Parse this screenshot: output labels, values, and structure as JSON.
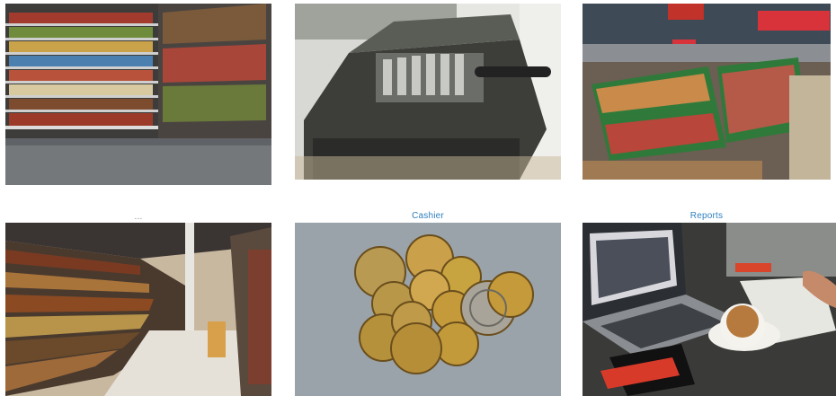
{
  "tiles": [
    {
      "name": "tile-supermarket-aisle",
      "caption": "",
      "image": "supermarket-shelves-photo"
    },
    {
      "name": "tile-cash-register",
      "caption": "",
      "image": "vintage-cash-register-photo"
    },
    {
      "name": "tile-produce-market",
      "caption": "",
      "image": "produce-stands-photo"
    },
    {
      "name": "tile-store-aisle",
      "caption": "...",
      "image": "store-aisle-photo"
    },
    {
      "name": "tile-cashier",
      "caption": "Cashier",
      "image": "coins-photo"
    },
    {
      "name": "tile-reports",
      "caption": "Reports",
      "image": "laptop-coffee-photo"
    }
  ]
}
